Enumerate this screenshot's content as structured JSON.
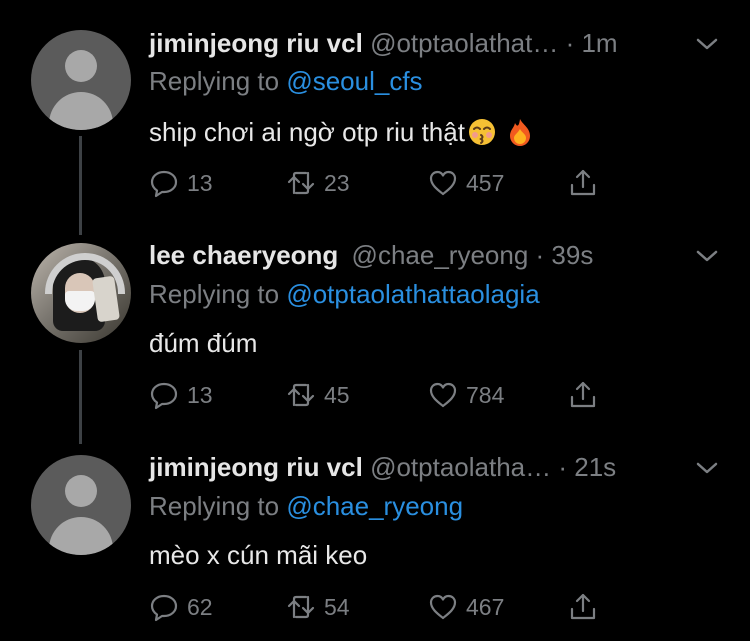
{
  "tweets": [
    {
      "name": "jiminjeong riu vcl",
      "handle": "@otptaolathat…",
      "time": "· 1m",
      "replying_prefix": "Replying to",
      "replying_to": "@seoul_cfs",
      "text": "ship chơi ai ngờ otp riu thật",
      "emojis": [
        "kissing-face-emoji",
        "fire-emoji"
      ],
      "replies": "13",
      "retweets": "23",
      "likes": "457"
    },
    {
      "name": "lee chaeryeong",
      "handle": "@chae_ryeong",
      "time": "· 39s",
      "replying_prefix": "Replying to",
      "replying_to": "@otptaolathattaolagia",
      "text": "đúm đúm",
      "replies": "13",
      "retweets": "45",
      "likes": "784"
    },
    {
      "name": "jiminjeong riu vcl",
      "handle": "@otptaolatha…",
      "time": "· 21s",
      "replying_prefix": "Replying to",
      "replying_to": "@chae_ryeong",
      "text": "mèo x cún mãi keo",
      "replies": "62",
      "retweets": "54",
      "likes": "467"
    }
  ],
  "icons": {
    "reply": "reply-icon",
    "retweet": "retweet-icon",
    "like": "heart-icon",
    "share": "share-icon",
    "menu": "chevron-down-icon"
  },
  "colors": {
    "background": "#000000",
    "mention": "#2a8fe0",
    "muted": "#7c7f83",
    "thread_line": "#3d4145"
  }
}
